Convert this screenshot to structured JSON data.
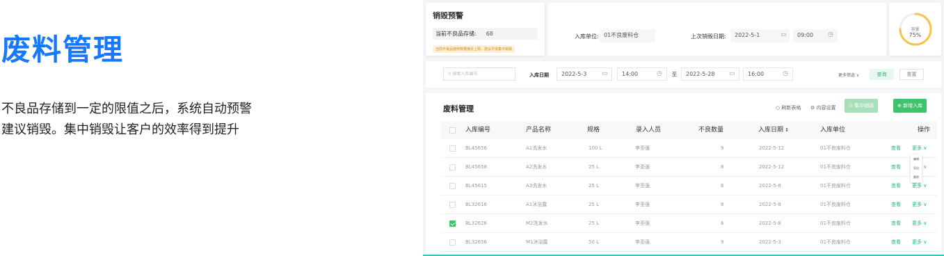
{
  "promo": {
    "title": "废料管理",
    "desc_line1": "不良品存储到一定的限值之后，系统自动预警",
    "desc_line2": "建议销毁。集中销毁让客户的效率得到提升"
  },
  "warning": {
    "title": "销毁预警",
    "stock_label": "当前不良品存储:",
    "stock_value": "68",
    "note": "当前不良品储存数量接近上限，建议尽快集中销毁"
  },
  "top_filters": {
    "unit_label": "入库单位:",
    "unit_value": "01不良废料仓",
    "last_destroy_label": "上次销毁日期:",
    "last_destroy_date": "2022-5-1",
    "last_destroy_time": "09:00"
  },
  "capacity": {
    "label": "容量",
    "value": "75%",
    "fraction": 0.75
  },
  "filter_bar": {
    "search_placeholder": "搜索入库编号",
    "date_label": "入库日期",
    "start_date": "2022-5-3",
    "start_time": "14:00",
    "to": "至",
    "end_date": "2022-5-28",
    "end_time": "16:00",
    "more_filter": "更多筛选",
    "query": "查询",
    "reset": "重置"
  },
  "table": {
    "title": "废料管理",
    "refresh": "刷新表格",
    "settings": "内容设置",
    "batch_destroy": "集中销毁",
    "add": "新增入库",
    "headers": [
      "入库编号",
      "产品名称",
      "规格",
      "录入人员",
      "不良数量",
      "入库日期",
      "入库单位",
      "操作"
    ],
    "view_label": "查看",
    "more_label": "更多",
    "rows": [
      {
        "id": "BL45656",
        "name": "A1洗发水",
        "spec": "100 L",
        "operator": "李圣强",
        "qty": "9",
        "date": "2022-5-12",
        "unit": "01不良废料仓",
        "checked": false
      },
      {
        "id": "BL45658",
        "name": "A2洗发水",
        "spec": "25 L",
        "operator": "李圣强",
        "qty": "8",
        "date": "2022-5-12",
        "unit": "01不良废料仓",
        "checked": false
      },
      {
        "id": "BL45615",
        "name": "A3洗发水",
        "spec": "25 L",
        "operator": "李圣强",
        "qty": "6",
        "date": "2022-5-8",
        "unit": "01不良废料仓",
        "checked": false
      },
      {
        "id": "BL32616",
        "name": "A1沐浴露",
        "spec": "25 L",
        "operator": "李圣强",
        "qty": "8",
        "date": "2022-5-8",
        "unit": "01不良废料仓",
        "checked": false
      },
      {
        "id": "BL32626",
        "name": "M2洗发水",
        "spec": "25 L",
        "operator": "李圣强",
        "qty": "6",
        "date": "2022-5-8",
        "unit": "01不良废料仓",
        "checked": true
      },
      {
        "id": "BL32656",
        "name": "M1沐浴露",
        "spec": "50 L",
        "operator": "李圣强",
        "qty": "9",
        "date": "2022-5-3",
        "unit": "01不良废料仓",
        "checked": false
      }
    ],
    "dropdown": [
      "编辑",
      "导出",
      "删除"
    ]
  },
  "colors": {
    "brand_blue": "#1677ff",
    "green": "#3ec26b",
    "ring": "#f6c350"
  }
}
